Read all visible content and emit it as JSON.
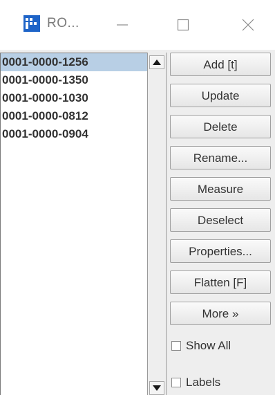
{
  "window": {
    "title": "RO...",
    "icon": "imagej-icon",
    "controls": [
      "minimize-icon",
      "maximize-icon",
      "close-icon"
    ]
  },
  "list": {
    "items": [
      {
        "label": "0001-0000-1256",
        "selected": true
      },
      {
        "label": "0001-0000-1350",
        "selected": false
      },
      {
        "label": "0001-0000-1030",
        "selected": false
      },
      {
        "label": "0001-0000-0812",
        "selected": false
      },
      {
        "label": "0001-0000-0904",
        "selected": false
      }
    ]
  },
  "buttons": {
    "add": "Add [t]",
    "update": "Update",
    "delete": "Delete",
    "rename": "Rename...",
    "measure": "Measure",
    "deselect": "Deselect",
    "properties": "Properties...",
    "flatten": "Flatten [F]",
    "more": "More »"
  },
  "checkboxes": {
    "show_all": {
      "label": "Show All",
      "checked": false
    },
    "labels": {
      "label": "Labels",
      "checked": false
    }
  },
  "colors": {
    "selection": "#b8cfe5",
    "icon_blue": "#1e64c8"
  }
}
